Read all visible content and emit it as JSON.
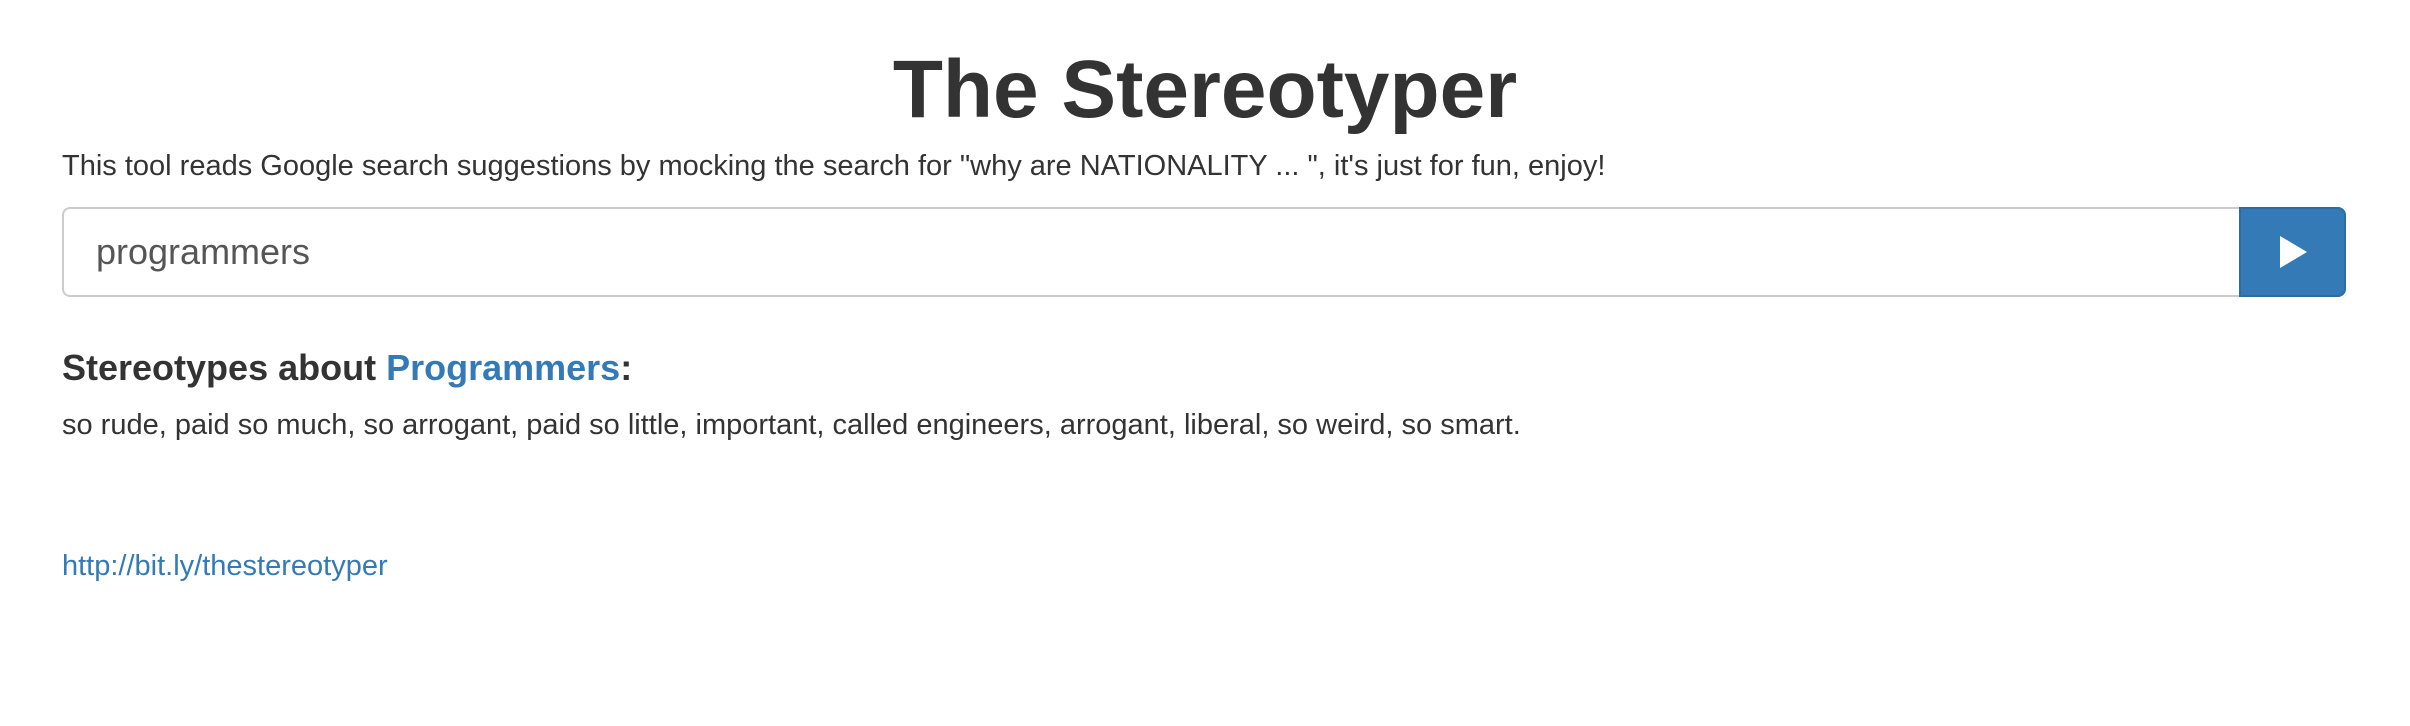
{
  "header": {
    "title": "The Stereotyper"
  },
  "intro": {
    "description": "This tool reads Google search suggestions by mocking the search for \"why are NATIONALITY ... \", it's just for fun, enjoy!"
  },
  "search": {
    "value": "programmers",
    "button_icon": "play-icon",
    "accent_color": "#337ab7"
  },
  "results": {
    "heading_prefix": "Stereotypes about ",
    "subject": "Programmers",
    "heading_suffix": ":",
    "stereotypes": "so rude, paid so much, so arrogant, paid so little, important, called engineers, arrogant, liberal, so weird, so smart."
  },
  "footer": {
    "link": "http://bit.ly/thestereotyper"
  }
}
